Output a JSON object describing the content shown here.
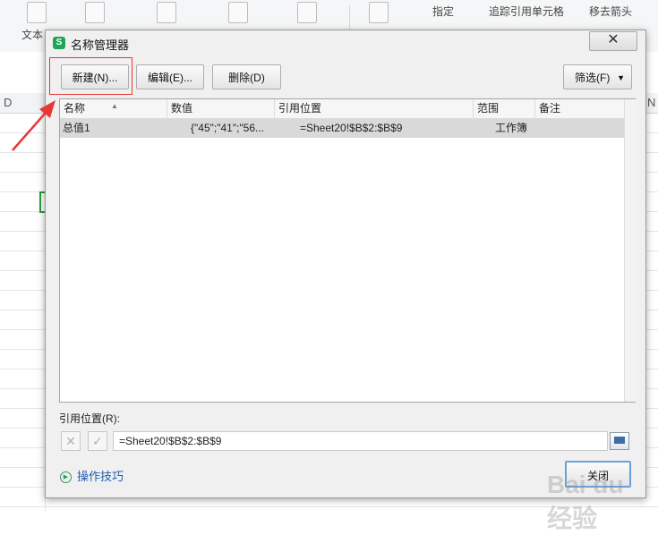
{
  "ribbon": {
    "items": [
      "文本",
      "指定",
      "追踪引用单元格",
      "移去箭头"
    ]
  },
  "sheet": {
    "columns": [
      "D",
      "N"
    ]
  },
  "dialog": {
    "title": "名称管理器",
    "close_glyph": "✕",
    "buttons": {
      "new": "新建(N)...",
      "edit": "编辑(E)...",
      "delete": "删除(D)",
      "filter": "筛选(F)"
    },
    "columns": [
      "名称",
      "数值",
      "引用位置",
      "范围",
      "备注"
    ],
    "rows": [
      {
        "name": "总值1",
        "value": "{\"45\";\"41\";\"56...",
        "refers_to": "=Sheet20!$B$2:$B$9",
        "scope": "工作簿",
        "comment": ""
      }
    ],
    "ref_label": "引用位置(R):",
    "ref_value": "=Sheet20!$B$2:$B$9",
    "tips": "操作技巧",
    "close_button": "关闭"
  },
  "watermark": "Bai du 经验",
  "colors": {
    "highlight": "#e53935",
    "row_selected": "#d9d9d9",
    "app_icon": "#21a35a",
    "tips_link": "#1f5fb3"
  }
}
